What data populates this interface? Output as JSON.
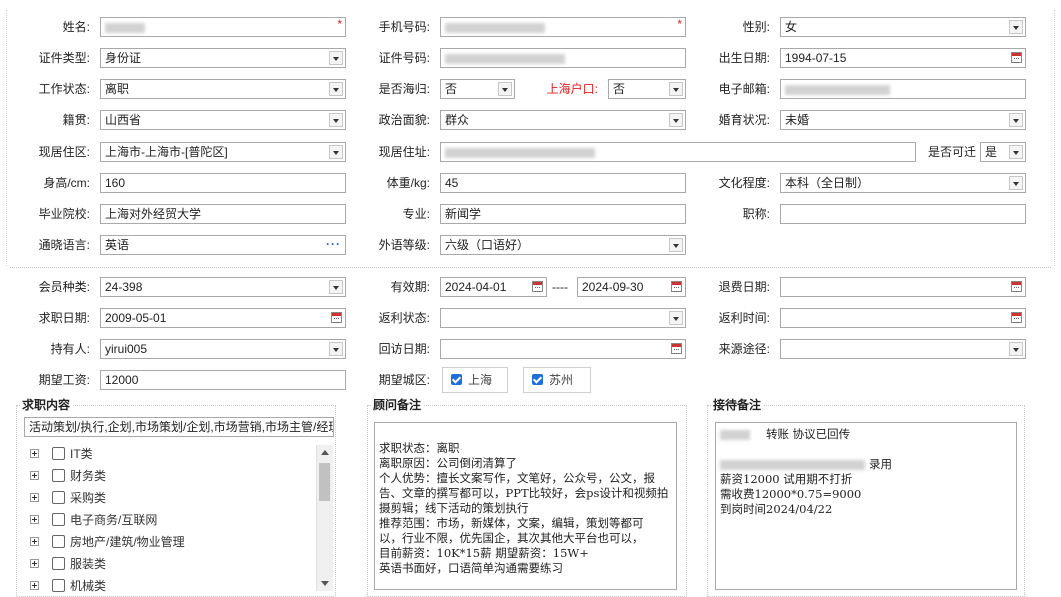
{
  "basic": {
    "name_label": "姓名:",
    "phone_label": "手机号码:",
    "gender_label": "性别:",
    "gender_value": "女",
    "idtype_label": "证件类型:",
    "idtype_value": "身份证",
    "idno_label": "证件号码:",
    "birth_label": "出生日期:",
    "birth_value": "1994-07-15",
    "workstatus_label": "工作状态:",
    "workstatus_value": "离职",
    "returnee_label": "是否海归:",
    "returnee_value": "否",
    "shhukou_label": "上海户口:",
    "shhukou_value": "否",
    "email_label": "电子邮箱:",
    "origin_label": "籍贯:",
    "origin_value": "山西省",
    "political_label": "政治面貌:",
    "political_value": "群众",
    "marital_label": "婚育状况:",
    "marital_value": "未婚",
    "region_label": "现居住区:",
    "region_value": "上海市-上海市-[普陀区]",
    "address_label": "现居住址:",
    "relocate_label": "是否可迁",
    "relocate_value": "是",
    "height_label": "身高/cm:",
    "height_value": "160",
    "weight_label": "体重/kg:",
    "weight_value": "45",
    "education_label": "文化程度:",
    "education_value": "本科（全日制）",
    "school_label": "毕业院校:",
    "school_value": "上海对外经贸大学",
    "major_label": "专业:",
    "major_value": "新闻学",
    "title_label": "职称:",
    "title_value": "",
    "lang_label": "通晓语言:",
    "lang_value": "英语",
    "langlevel_label": "外语等级:",
    "langlevel_value": "六级（口语好）"
  },
  "member": {
    "type_label": "会员种类:",
    "type_value": "24-398",
    "valid_label": "有效期:",
    "valid_from": "2024-04-01",
    "valid_sep": "----",
    "valid_to": "2024-09-30",
    "refund_label": "退费日期:",
    "jobdate_label": "求职日期:",
    "jobdate_value": "2009-05-01",
    "rebate_label": "返利状态:",
    "rebatetime_label": "返利时间:",
    "holder_label": "持有人:",
    "holder_value": "yirui005",
    "visit_label": "回访日期:",
    "source_label": "来源途径:",
    "salary_label": "期望工资:",
    "salary_value": "12000",
    "city_label": "期望城区:",
    "city1": "上海",
    "city2": "苏州"
  },
  "job": {
    "legend": "求职内容",
    "summary": "活动策划/执行,企划,市场策划/企划,市场营销,市场主管/经理",
    "categories": [
      "IT类",
      "财务类",
      "采购类",
      "电子商务/互联网",
      "房地产/建筑/物业管理",
      "服装类",
      "机械类"
    ]
  },
  "advisor": {
    "legend": "顾问备注",
    "lines": [
      "求职状态：离职",
      "离职原因：公司倒闭清算了",
      "个人优势：擅长文案写作，文笔好，公众号，公文，报",
      "告、文章的撰写都可以，PPT比较好，会ps设计和视频拍",
      "摄剪辑；线下活动的策划执行",
      "推荐范围：市场，新媒体，文案，编辑，策划等都可",
      "以，行业不限，优先国企，其次其他大平台也可以，",
      "目前薪资：10K*15薪    期望薪资：15W+",
      "英语书面好，口语简单沟通需要练习"
    ]
  },
  "reception": {
    "legend": "接待备注",
    "line1": "转账   协议已回传",
    "line2": "录用",
    "line3": "薪资12000  试用期不打折",
    "line4": "需收费12000*0.75=9000",
    "line5": "到岗时间2024/04/22"
  }
}
